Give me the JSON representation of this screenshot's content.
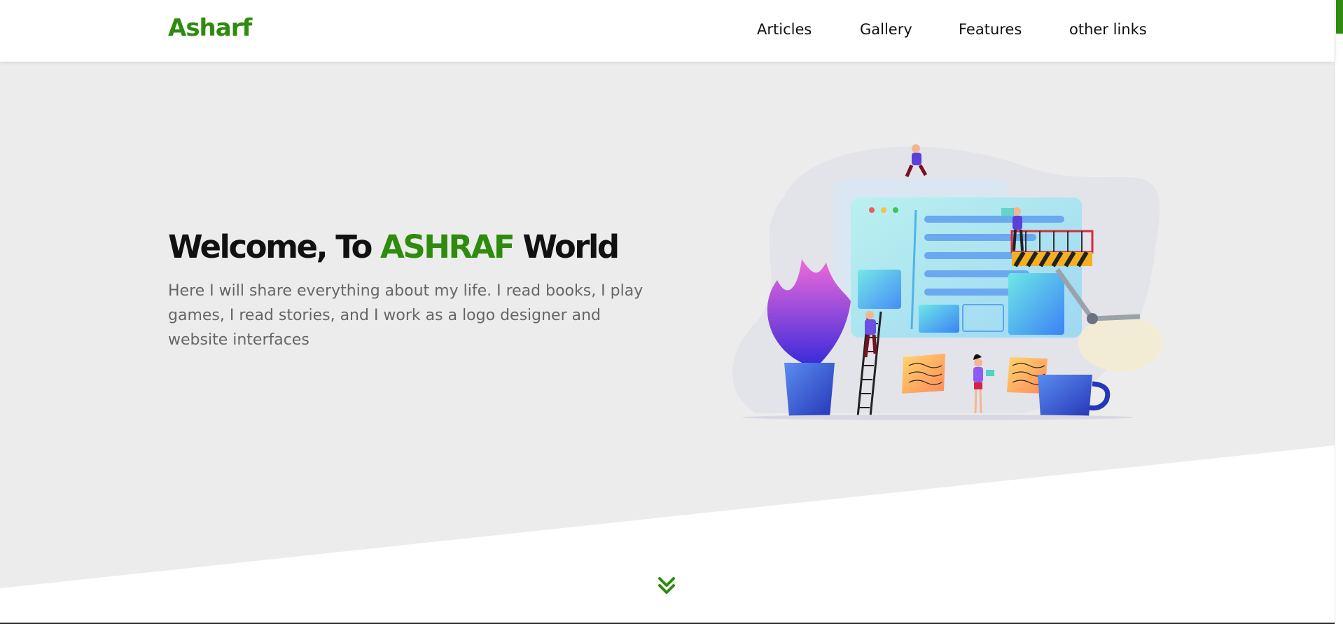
{
  "brand": {
    "name": "Asharf"
  },
  "nav": {
    "items": [
      {
        "label": "Articles"
      },
      {
        "label": "Gallery"
      },
      {
        "label": "Features"
      },
      {
        "label": "other links"
      }
    ]
  },
  "hero": {
    "title_prefix": "Welcome, To ",
    "title_accent": "ASHRAF",
    "title_suffix": " World",
    "description": "Here I will share everything about my life. I read books, I play games, I read stories, and I work as a logo designer and website interfaces"
  },
  "icons": {
    "scroll_down": "double-chevron-down-icon"
  },
  "colors": {
    "accent": "#2e8b0e",
    "hero_background": "#ececec",
    "text": "#111111",
    "muted_text": "#666666"
  }
}
